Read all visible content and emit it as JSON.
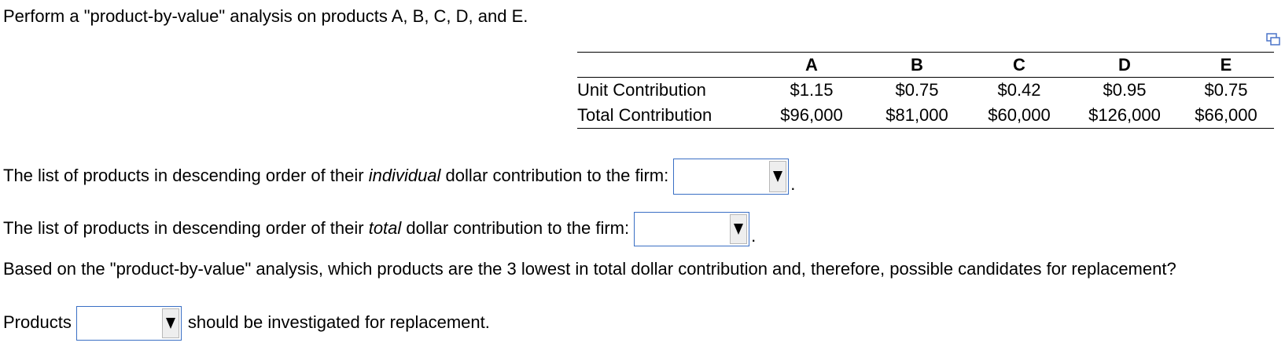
{
  "intro": "Perform a \"product-by-value\" analysis on products A, B, C, D, and E.",
  "table": {
    "headers": [
      "",
      "A",
      "B",
      "C",
      "D",
      "E"
    ],
    "rows": [
      {
        "label": "Unit Contribution",
        "values": [
          "$1.15",
          "$0.75",
          "$0.42",
          "$0.95",
          "$0.75"
        ]
      },
      {
        "label": "Total Contribution",
        "values": [
          "$96,000",
          "$81,000",
          "$60,000",
          "$126,000",
          "$66,000"
        ]
      }
    ]
  },
  "q1": {
    "before": "The list of products in descending order of their ",
    "emphasis": "individual",
    "after": " dollar contribution to the firm:",
    "value": "",
    "end": "."
  },
  "q2": {
    "before": "The list of products in descending order of their ",
    "emphasis": "total",
    "after": " dollar contribution to the firm:",
    "value": "",
    "end": "."
  },
  "q3": {
    "text": "Based on the \"product-by-value\" analysis, which products are the 3 lowest in total dollar contribution and, therefore, possible candidates for replacement?"
  },
  "q4": {
    "before": "Products",
    "value": "",
    "after": "should be investigated for replacement."
  },
  "icons": {
    "copy": "copy-icon",
    "dropdown": "triangle-down-icon"
  },
  "colors": {
    "dropdown_border": "#3a6fc4",
    "copy_icon": "#4a74c9"
  }
}
